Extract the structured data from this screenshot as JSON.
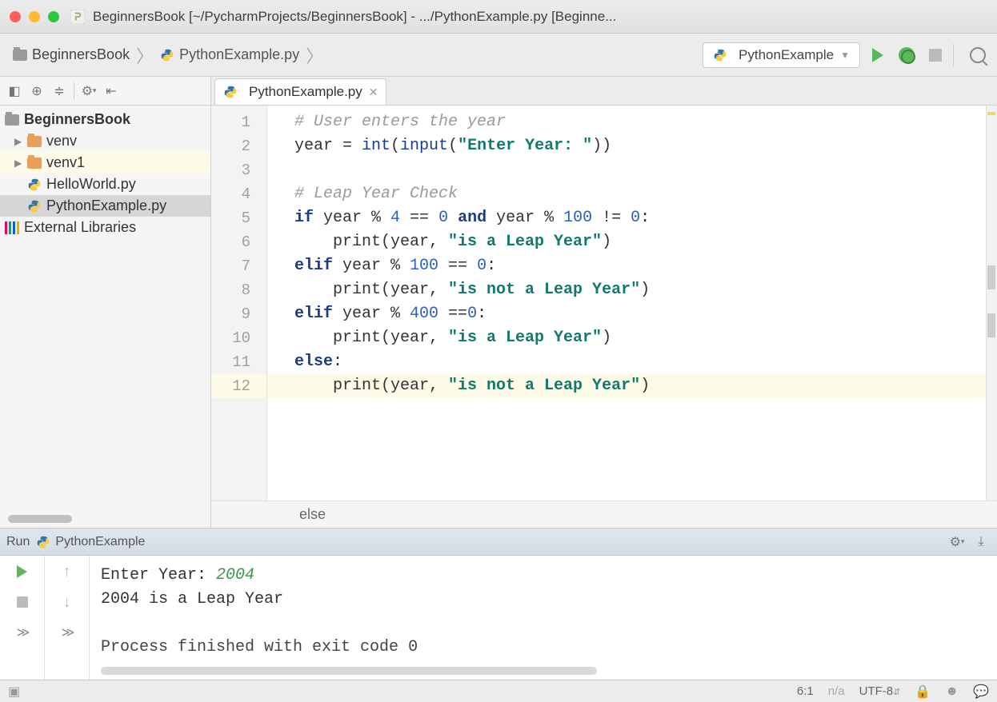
{
  "titlebar": {
    "title": "BeginnersBook [~/PycharmProjects/BeginnersBook] - .../PythonExample.py [Beginne..."
  },
  "breadcrumb": {
    "project": "BeginnersBook",
    "file": "PythonExample.py"
  },
  "run_config": {
    "name": "PythonExample"
  },
  "project_tree": {
    "root": "BeginnersBook",
    "items": [
      {
        "label": "venv",
        "type": "folder"
      },
      {
        "label": "venv1",
        "type": "folder"
      },
      {
        "label": "HelloWorld.py",
        "type": "py"
      },
      {
        "label": "PythonExample.py",
        "type": "py",
        "selected": true
      }
    ],
    "external": "External Libraries"
  },
  "editor": {
    "tab": "PythonExample.py",
    "gutter": [
      "1",
      "2",
      "3",
      "4",
      "5",
      "6",
      "7",
      "8",
      "9",
      "10",
      "11",
      "12"
    ],
    "code": {
      "l1_comment": "# User enters the year",
      "l2_a": "year = ",
      "l2_int": "int",
      "l2_p1": "(",
      "l2_input": "input",
      "l2_p2": "(",
      "l2_str": "\"Enter Year: \"",
      "l2_p3": "))",
      "l4_comment": "# Leap Year Check",
      "l5_if": "if",
      "l5_a": " year % ",
      "l5_n4": "4",
      "l5_b": " == ",
      "l5_n0a": "0",
      "l5_and": " and ",
      "l5_c": "year % ",
      "l5_n100": "100",
      "l5_d": " != ",
      "l5_n0b": "0",
      "l5_e": ":",
      "l6_a": "    print(year, ",
      "l6_str": "\"is a Leap Year\"",
      "l6_b": ")",
      "l7_elif": "elif",
      "l7_a": " year % ",
      "l7_n100": "100",
      "l7_b": " == ",
      "l7_n0": "0",
      "l7_c": ":",
      "l8_a": "    print(year, ",
      "l8_str": "\"is not a Leap Year\"",
      "l8_b": ")",
      "l9_elif": "elif",
      "l9_a": " year % ",
      "l9_n400": "400",
      "l9_b": " ==",
      "l9_n0": "0",
      "l9_c": ":",
      "l10_a": "    print(year, ",
      "l10_str": "\"is a Leap Year\"",
      "l10_b": ")",
      "l11_else": "else",
      "l11_a": ":",
      "l12_a": "    print(year, ",
      "l12_str": "\"is not a Leap Year\"",
      "l12_b": ")"
    },
    "crumb": "else"
  },
  "run": {
    "label": "Run",
    "config": "PythonExample",
    "out_prompt": "Enter Year: ",
    "out_input": "2004",
    "out_result": "2004 is a Leap Year",
    "out_exit": "Process finished with exit code 0"
  },
  "status": {
    "pos": "6:1",
    "sep": "n/a",
    "enc": "UTF-8"
  }
}
